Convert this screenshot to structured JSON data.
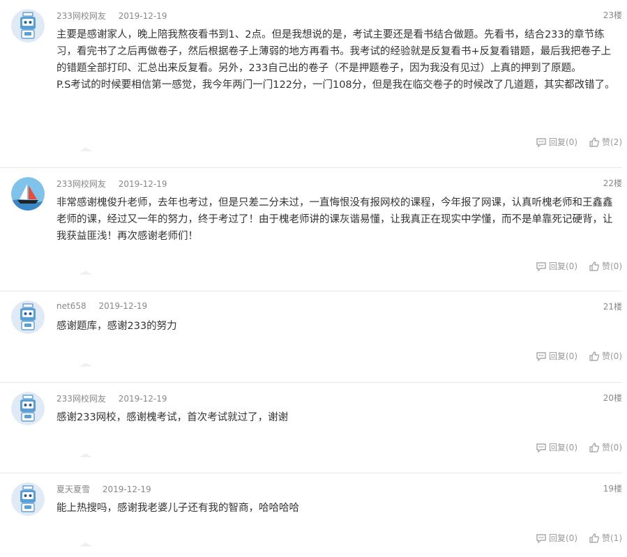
{
  "comments": [
    {
      "user": "233网校网友",
      "date": "2019-12-19",
      "floor": "23楼",
      "avatar": "robot-avatar",
      "lines": [
        "主要是感谢家人，晚上陪我熬夜看书到1、2点。但是我想说的是，考试主要还是看书结合做题。先看书，结合233的章节练习，看完书了之后再做卷子，然后根据卷子上薄弱的地方再看书。我考试的经验就是反复看书+反复看错题，最后我把卷子上的错题全部打印、汇总出来反复看。另外，233自己出的卷子（不是押题卷子，因为我没有见过）上真的押到了原题。",
        "P.S考试的时候要相信第一感觉，我今年两门一门122分，一门108分，但是我在临交卷子的时候改了几道题，其实都改错了。"
      ],
      "reply": "回复(0)",
      "like": "赞(2)"
    },
    {
      "user": "233网校网友",
      "date": "2019-12-19",
      "floor": "22楼",
      "avatar": "sailboat-avatar",
      "lines": [
        "非常感谢槐俊升老师，去年也考过，但是只差二分未过，一直悔恨没有报网校的课程，今年报了网课，认真听槐老师和王鑫鑫老师的课，经过又一年的努力，终于考过了！由于槐老师讲的课灰谐易懂，让我真正在现实中学懂，而不是单靠死记硬背，让我获益匪浅！再次感谢老师们！"
      ],
      "reply": "回复(0)",
      "like": "赞(0)"
    },
    {
      "user": "net658",
      "date": "2019-12-19",
      "floor": "21楼",
      "avatar": "robot-avatar",
      "lines": [
        "感谢题库，感谢233的努力"
      ],
      "reply": "回复(0)",
      "like": "赞(0)"
    },
    {
      "user": "233网校网友",
      "date": "2019-12-19",
      "floor": "20楼",
      "avatar": "robot-avatar",
      "lines": [
        "感谢233网校，感谢槐考试，首次考试就过了，谢谢"
      ],
      "reply": "回复(0)",
      "like": "赞(0)"
    },
    {
      "user": "夏天夏雪",
      "date": "2019-12-19",
      "floor": "19楼",
      "avatar": "robot-avatar",
      "lines": [
        "能上热搜吗，感谢我老婆儿子还有我的智商，哈哈哈哈"
      ],
      "reply": "回复(0)",
      "like": "赞(1)"
    }
  ],
  "colors": {
    "text": "#333333",
    "meta": "#888888",
    "divider": "#e8e8e8",
    "robot_blue": "#5aa0d8"
  },
  "icons": {
    "reply": "speech-bubble-icon",
    "like": "thumbs-up-icon"
  }
}
